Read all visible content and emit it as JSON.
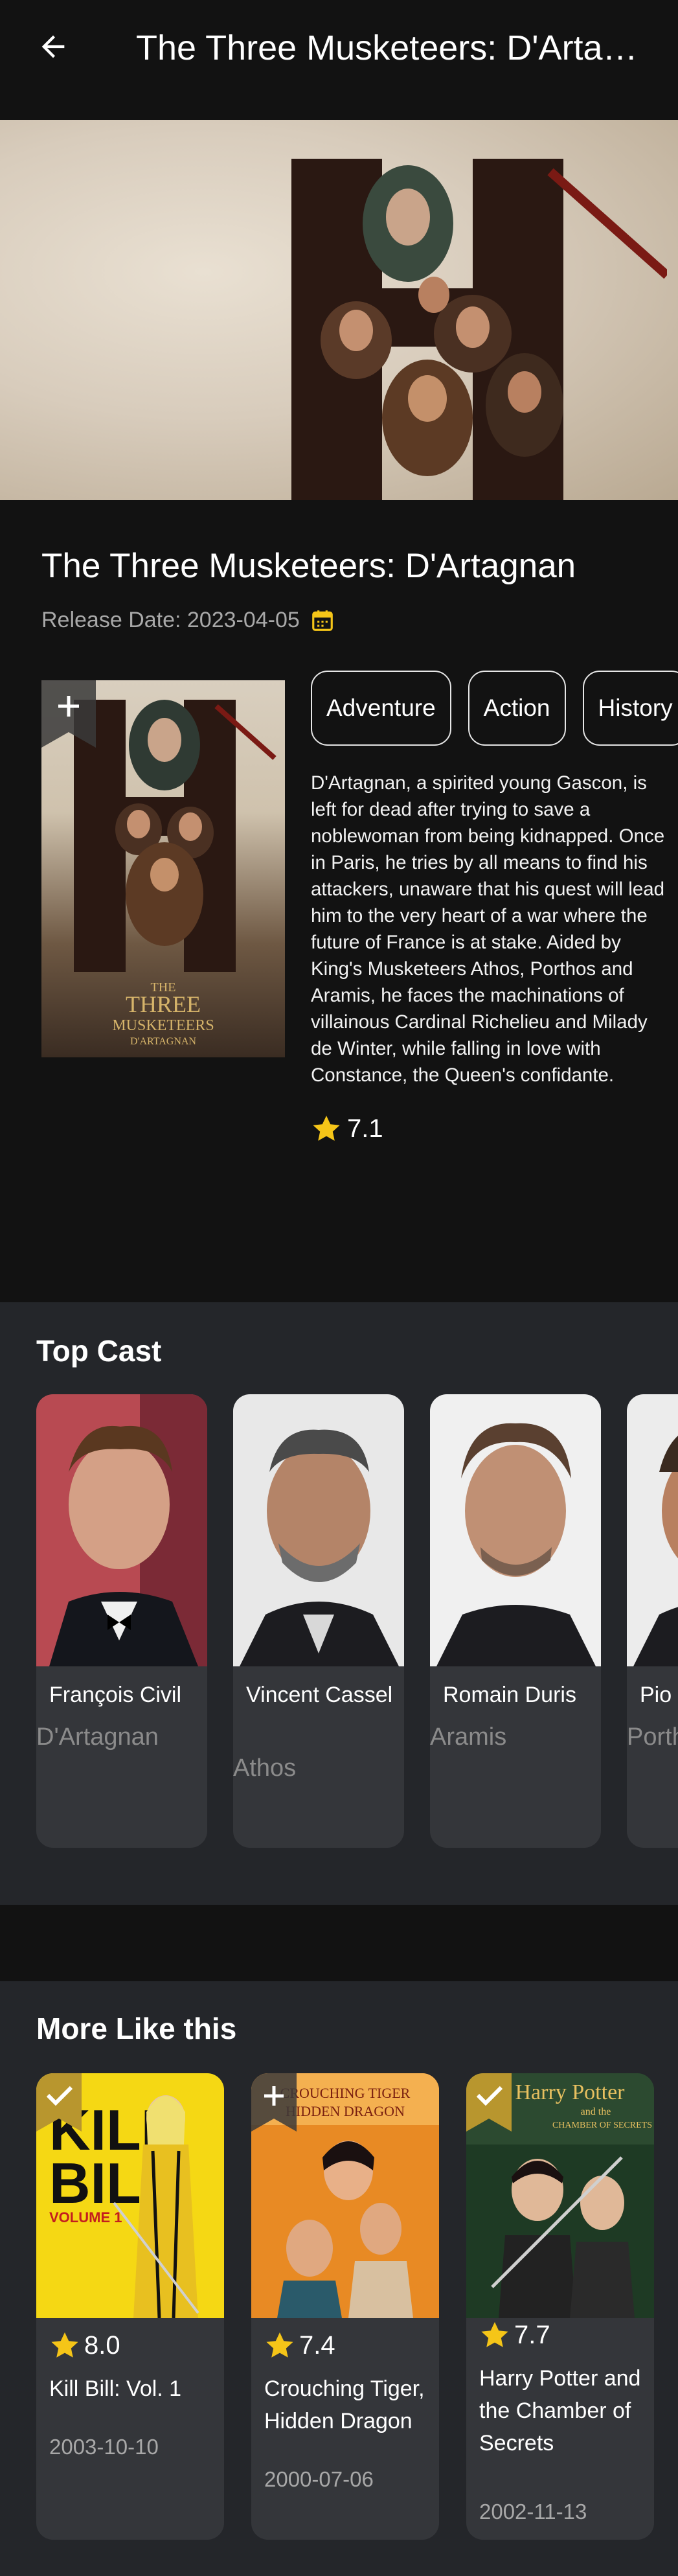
{
  "appbar": {
    "title": "The Three Musketeers: D'Artag..."
  },
  "movie": {
    "title": "The Three Musketeers: D'Artagnan",
    "release_label": "Release Date: 2023-04-05",
    "genres": [
      "Adventure",
      "Action",
      "History"
    ],
    "overview": "D'Artagnan, a spirited young Gascon, is left for dead after trying to save a noblewoman from being kidnapped. Once in Paris, he tries by all means to find his attackers, unaware that his quest will lead him to the very heart of a war where the future of France is at stake. Aided by King's Musketeers Athos, Porthos and Aramis, he faces the machinations of villainous Cardinal Richelieu and Milady de Winter, while falling in love with Constance, the Queen's confidante.",
    "rating": "7.1",
    "poster_text": {
      "line1": "THE",
      "line2": "THREE",
      "line3": "MUSKETEERS",
      "line4": "D'ARTAGNAN"
    }
  },
  "cast": {
    "title": "Top Cast",
    "items": [
      {
        "name": "François Civil",
        "character": "D'Artagnan"
      },
      {
        "name": "Vincent Cassel",
        "character": "Athos"
      },
      {
        "name": "Romain Duris",
        "character": "Aramis"
      },
      {
        "name": "Pio Marmaï",
        "character": "Porthos"
      }
    ]
  },
  "more": {
    "title": "More Like this",
    "items": [
      {
        "rating": "8.0",
        "title": "Kill Bill: Vol. 1",
        "date": "2003-10-10",
        "poster_line1": "KILL",
        "poster_line2": "BILL",
        "poster_line3": "VOLUME 1"
      },
      {
        "rating": "7.4",
        "title": "Crouching Tiger, Hidden Dragon",
        "date": "2000-07-06",
        "poster_line1": "CROUCHING TIGER",
        "poster_line2": "HIDDEN DRAGON"
      },
      {
        "rating": "7.7",
        "title": "Harry Potter and the Chamber of Secrets",
        "date": "2002-11-13",
        "poster_line1": "Harry Potter",
        "poster_line2": "and the",
        "poster_line3": "CHAMBER OF SECRETS"
      }
    ]
  },
  "colors": {
    "background": "#121212",
    "section": "#24262a",
    "card": "#34363a",
    "star": "#f5c518",
    "calendar": "#f5c518",
    "bookmark_added": "#b8962e"
  }
}
